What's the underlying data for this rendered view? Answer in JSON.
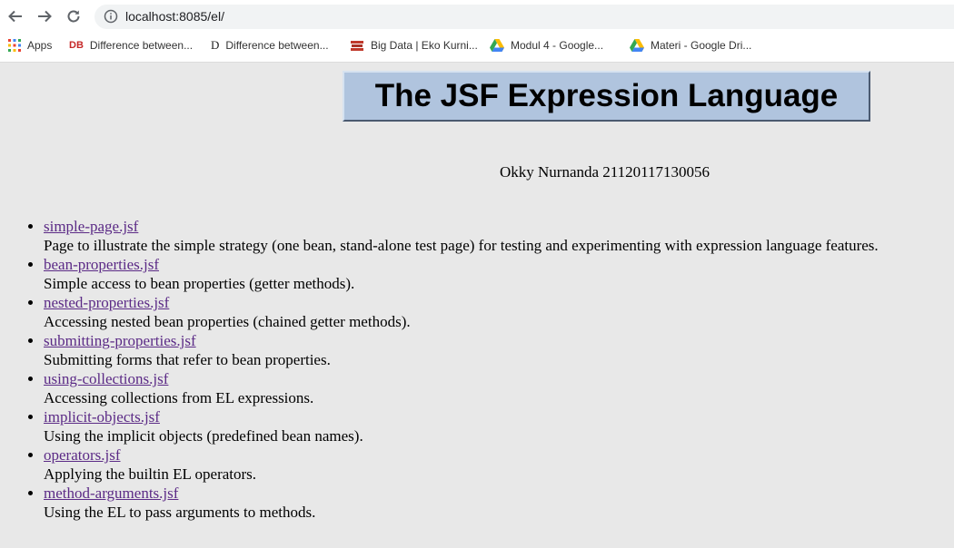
{
  "browser": {
    "url": "localhost:8085/el/",
    "bookmarks": [
      {
        "label": "Apps",
        "icon": "apps-grid-icon"
      },
      {
        "label": "Difference between...",
        "icon": "db-icon"
      },
      {
        "label": "Difference between...",
        "icon": "d-letter-icon"
      },
      {
        "label": "Big Data | Eko Kurni...",
        "icon": "red-books-icon"
      },
      {
        "label": "Modul 4 - Google...",
        "icon": "google-drive-icon"
      },
      {
        "label": "Materi - Google Dri...",
        "icon": "google-drive-icon"
      }
    ]
  },
  "page": {
    "title": "The JSF Expression Language",
    "author": "Okky Nurnanda 21120117130056",
    "items": [
      {
        "link": "simple-page.jsf",
        "desc": "Page to illustrate the simple strategy (one bean, stand-alone test page) for testing and experimenting with expression language features."
      },
      {
        "link": "bean-properties.jsf",
        "desc": "Simple access to bean properties (getter methods)."
      },
      {
        "link": "nested-properties.jsf",
        "desc": "Accessing nested bean properties (chained getter methods)."
      },
      {
        "link": "submitting-properties.jsf",
        "desc": "Submitting forms that refer to bean properties."
      },
      {
        "link": "using-collections.jsf",
        "desc": "Accessing collections from EL expressions."
      },
      {
        "link": "implicit-objects.jsf",
        "desc": "Using the implicit objects (predefined bean names)."
      },
      {
        "link": "operators.jsf",
        "desc": "Applying the builtin EL operators."
      },
      {
        "link": "method-arguments.jsf",
        "desc": "Using the EL to pass arguments to methods."
      }
    ]
  }
}
